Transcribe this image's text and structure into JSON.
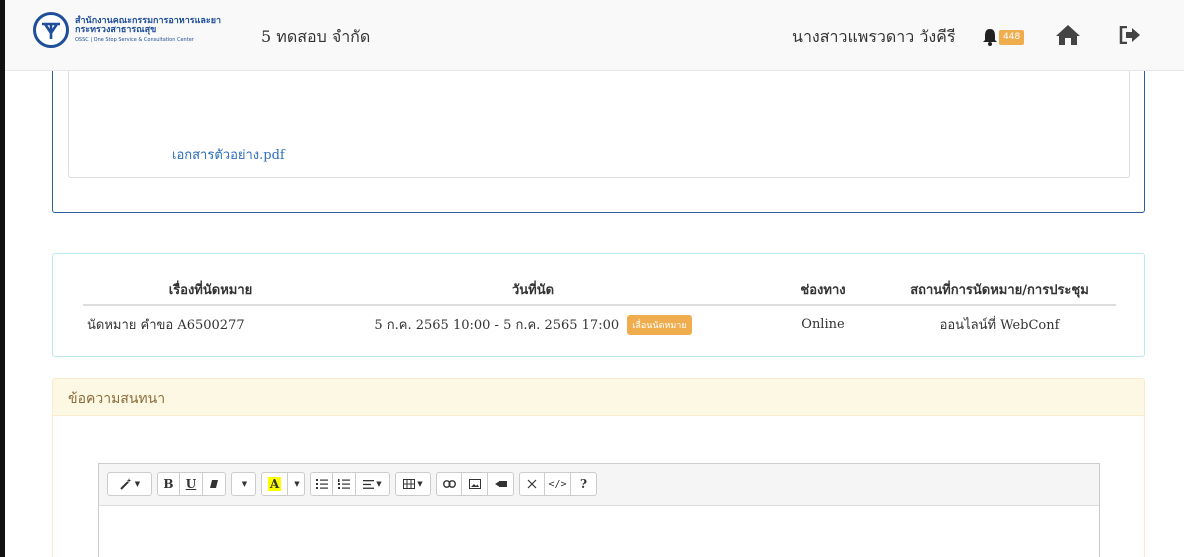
{
  "header": {
    "logo": {
      "line1": "สำนักงานคณะกรรมการอาหารและยา",
      "line2": "กระทรวงสาธารณสุข",
      "line3": "OSSC | One Stop Service & Consultation Center"
    },
    "company": "5 ทดสอบ จำกัด",
    "user_name": "นางสาวแพรวดาว วังคีรี",
    "notification_count": "448",
    "icons": [
      "bell-icon",
      "home-icon",
      "logout-icon"
    ]
  },
  "documents": {
    "file_link": "เอกสารตัวอย่าง.pdf"
  },
  "appointments": {
    "columns": [
      "เรื่องที่นัดหมาย",
      "วันที่นัด",
      "ช่องทาง",
      "สถานที่การนัดหมาย/การประชุม"
    ],
    "rows": [
      {
        "subject": "นัดหมาย คำขอ A6500277",
        "date": "5 ก.ค. 2565 10:00 - 5 ก.ค. 2565 17:00",
        "action": "เลื่อนนัดหมาย",
        "channel": "Online",
        "location": "ออนไลน์ที่ WebConf"
      }
    ]
  },
  "chat": {
    "title": "ข้อความสนทนา",
    "toolbar": {
      "bold": "B",
      "underline": "U",
      "font_color": "A",
      "code_view": "</>",
      "help": "?"
    }
  },
  "colors": {
    "brand_blue": "#1f4e9a",
    "badge_orange": "#f0ad4e",
    "link": "#2a6ebb",
    "chat_header_bg": "#fcf8e3"
  }
}
